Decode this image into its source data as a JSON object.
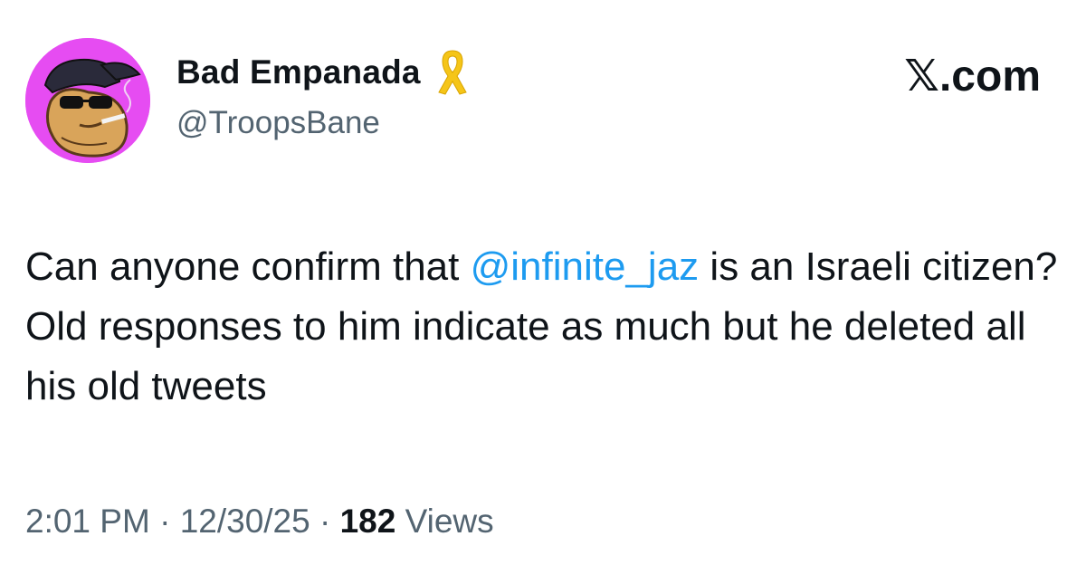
{
  "author": {
    "display_name": "Bad Empanada",
    "handle": "@TroopsBane",
    "badge_icon": "yellow-ribbon-icon",
    "avatar_background": "#e64cf2"
  },
  "brand": "𝕏.com",
  "tweet": {
    "text_before_mention": "Can anyone confirm that ",
    "mention": "@infinite_jaz",
    "text_after_mention": " is an Israeli citizen? Old responses to him indicate as much but he deleted all his old tweets"
  },
  "meta": {
    "time": "2:01 PM",
    "separator": " · ",
    "date": "12/30/25",
    "views_count": "182",
    "views_label": " Views"
  },
  "colors": {
    "mention": "#1d9bf0",
    "secondary_text": "#536471",
    "primary_text": "#0f1419",
    "ribbon": "#f5c518"
  }
}
